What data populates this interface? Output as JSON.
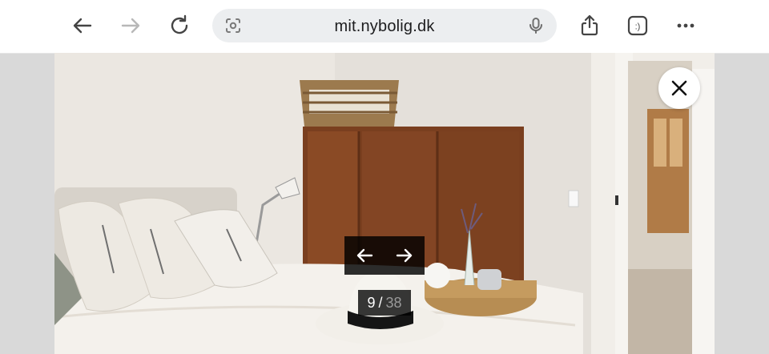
{
  "browser": {
    "url": "mit.nybolig.dk",
    "back_icon": "arrow-left-icon",
    "forward_icon": "arrow-right-icon",
    "reload_icon": "reload-icon",
    "lens_icon": "camera-search-icon",
    "mic_icon": "microphone-icon",
    "share_icon": "share-icon",
    "tabs_icon": "tabs-smiley-icon",
    "more_icon": "more-dots-icon",
    "tabs_glyph": ":)"
  },
  "gallery": {
    "current": "9",
    "separator": "/",
    "total": "38",
    "prev_icon": "arrow-left-icon",
    "next_icon": "arrow-right-icon",
    "close_icon": "close-icon",
    "photo_subject": "bedroom-with-wardrobe-photo"
  },
  "colors": {
    "toolbar_bg": "#ffffff",
    "urlbar_bg": "#eceef0",
    "overlay_bg": "#000000",
    "side_bg": "#d9d9d9"
  }
}
